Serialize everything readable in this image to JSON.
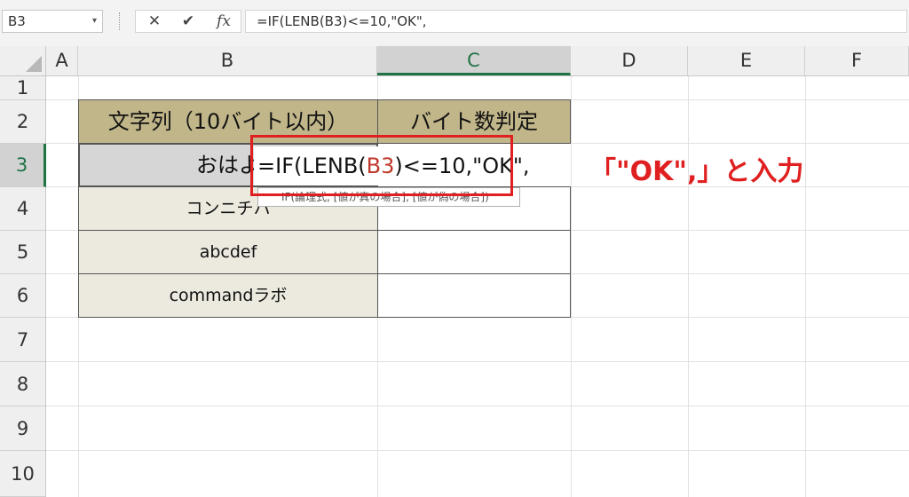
{
  "formula_bar": {
    "name_box": "B3",
    "name_box_arrow": "▾",
    "cancel_icon": "✕",
    "enter_icon": "✔",
    "fx_label": "fx",
    "formula": "=IF(LENB(B3)<=10,\"OK\","
  },
  "grid": {
    "columns": [
      "A",
      "B",
      "C",
      "D",
      "E",
      "F"
    ],
    "rows": [
      "1",
      "2",
      "3",
      "4",
      "5",
      "6",
      "7",
      "8",
      "9",
      "10"
    ],
    "selected_column": "C",
    "selected_row": "3"
  },
  "table": {
    "header_b": "文字列（10バイト以内）",
    "header_c": "バイト数判定",
    "b3_visible": "おはよ",
    "b4": "コンニチハ",
    "b5": "abcdef",
    "b6": "commandラボ"
  },
  "edit": {
    "part1": "=IF(LENB(",
    "ref": "B3",
    "part2": ")<=10,\"OK\","
  },
  "tooltip": "IF(論理式, [値が真の場合], [値が偽の場合])",
  "annotation": "「\"OK\",」と入力",
  "colors": {
    "header_fill": "#c1b68a",
    "data_fill": "#ece9df",
    "annotation_red": "#e02020",
    "excel_green": "#217346"
  }
}
